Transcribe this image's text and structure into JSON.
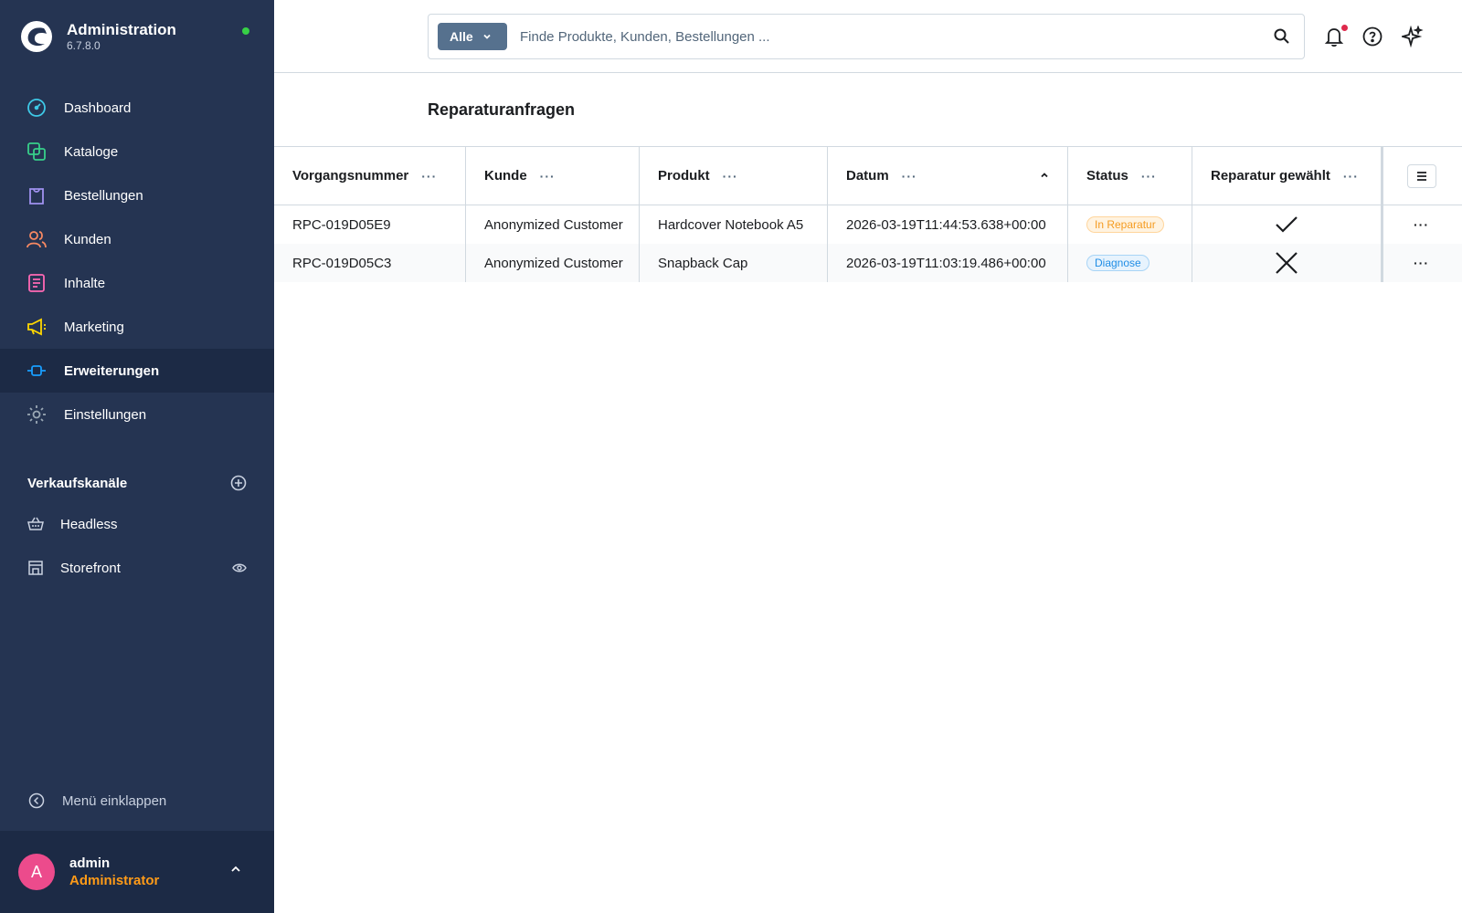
{
  "app": {
    "title": "Administration",
    "version": "6.7.8.0"
  },
  "sidebar": {
    "items": [
      {
        "label": "Dashboard",
        "icon": "dashboard-icon",
        "color": "#3ec9e7"
      },
      {
        "label": "Kataloge",
        "icon": "catalog-icon",
        "color": "#37d08a"
      },
      {
        "label": "Bestellungen",
        "icon": "shopping-bag-icon",
        "color": "#a092f0"
      },
      {
        "label": "Kunden",
        "icon": "users-icon",
        "color": "#f88962"
      },
      {
        "label": "Inhalte",
        "icon": "content-icon",
        "color": "#ff68b4"
      },
      {
        "label": "Marketing",
        "icon": "megaphone-icon",
        "color": "#ffd700"
      },
      {
        "label": "Erweiterungen",
        "icon": "plug-icon",
        "color": "#189eff",
        "active": true
      },
      {
        "label": "Einstellungen",
        "icon": "gear-icon",
        "color": "#9aa8b5"
      }
    ],
    "channels_title": "Verkaufskanäle",
    "channels": [
      {
        "label": "Headless",
        "icon": "basket-icon"
      },
      {
        "label": "Storefront",
        "icon": "storefront-icon"
      }
    ],
    "collapse_label": "Menü einklappen",
    "user": {
      "initial": "A",
      "name": "admin",
      "role": "Administrator"
    }
  },
  "search": {
    "type_label": "Alle",
    "placeholder": "Finde Produkte, Kunden, Bestellungen ..."
  },
  "page": {
    "title": "Reparaturanfragen"
  },
  "grid": {
    "columns": [
      "Vorgangsnummer",
      "Kunde",
      "Produkt",
      "Datum",
      "Status",
      "Reparatur gewählt"
    ],
    "rows": [
      {
        "number": "RPC-019D05E9",
        "customer": "Anonymized Customer",
        "product": "Hardcover Notebook A5",
        "date": "2026-03-19T11:44:53.638+00:00",
        "status": "In Reparatur",
        "repair_selected": true
      },
      {
        "number": "RPC-019D05C3",
        "customer": "Anonymized Customer",
        "product": "Snapback Cap",
        "date": "2026-03-19T11:03:19.486+00:00",
        "status": "Diagnose",
        "repair_selected": false
      }
    ]
  }
}
